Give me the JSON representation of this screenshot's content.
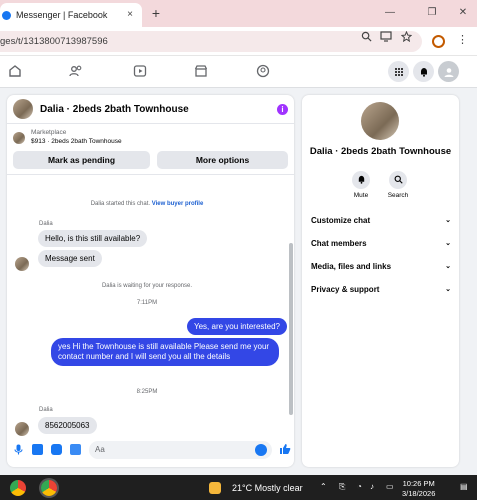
{
  "browser": {
    "tab_title": "Messenger | Facebook",
    "tab_close": "×",
    "new_tab": "+",
    "minimize": "—",
    "restore": "❐",
    "close": "✕",
    "url": "ges/t/1313800713987596",
    "menu": "⋮"
  },
  "chat": {
    "title": "Dalia · 2beds 2bath Townhouse",
    "info": "i",
    "marketplace_label": "Marketplace",
    "listing": "$913 · 2beds 2bath Townhouse",
    "pending_button": "Mark as pending",
    "more_options_button": "More options",
    "started_text": "Dalia started this chat.",
    "view_buyer_link": "View buyer profile",
    "sender_1": "Dalia",
    "msg_1": "Hello, is this still available?",
    "msg_2": "Message sent",
    "waiting_text": "Dalia is waiting for your response.",
    "time_1": "7:11PM",
    "out_1": "Yes, are you interested?",
    "out_2": "yes Hi the Townhouse is still available Please send me your contact number and I will send you all the details",
    "time_2": "8:25PM",
    "sender_2": "Dalia",
    "msg_3": "8562005063",
    "composer_placeholder": "Aa"
  },
  "info_panel": {
    "name": "Dalia · 2beds 2bath Townhouse",
    "mute_label": "Mute",
    "search_label": "Search",
    "sections": [
      "Customize chat",
      "Chat members",
      "Media, files and links",
      "Privacy & support"
    ]
  },
  "taskbar": {
    "temperature": "21°C",
    "condition": "Mostly clear",
    "time": "10:26 PM",
    "date": "3/18/2026"
  }
}
